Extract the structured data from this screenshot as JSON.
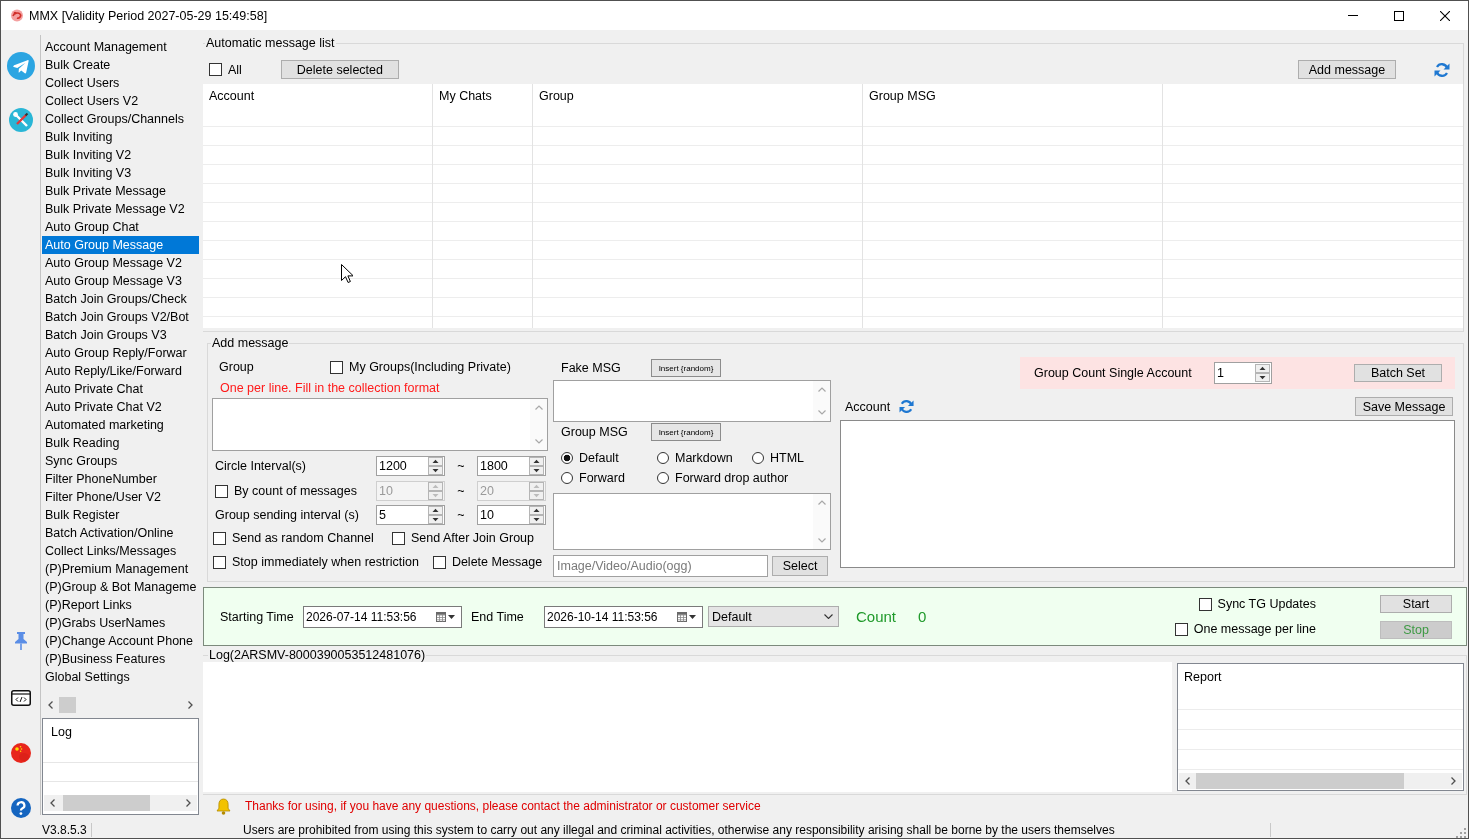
{
  "window": {
    "title": "MMX [Validity Period 2027-05-29 15:49:58]"
  },
  "sidebar": {
    "items": [
      {
        "label": "Account Management",
        "selected": false
      },
      {
        "label": "Bulk Create",
        "selected": false
      },
      {
        "label": "Collect Users",
        "selected": false
      },
      {
        "label": "Collect Users V2",
        "selected": false
      },
      {
        "label": "Collect Groups/Channels",
        "selected": false
      },
      {
        "label": "Bulk Inviting",
        "selected": false
      },
      {
        "label": "Bulk Inviting V2",
        "selected": false
      },
      {
        "label": "Bulk Inviting V3",
        "selected": false
      },
      {
        "label": "Bulk Private Message",
        "selected": false
      },
      {
        "label": "Bulk Private Message V2",
        "selected": false
      },
      {
        "label": "Auto Group Chat",
        "selected": false
      },
      {
        "label": "Auto Group Message",
        "selected": true
      },
      {
        "label": "Auto Group Message V2",
        "selected": false
      },
      {
        "label": "Auto Group Message V3",
        "selected": false
      },
      {
        "label": "Batch Join Groups/Check",
        "selected": false
      },
      {
        "label": "Batch Join Groups V2/Bot",
        "selected": false
      },
      {
        "label": "Batch Join Groups V3",
        "selected": false
      },
      {
        "label": "Auto Group Reply/Forwar",
        "selected": false
      },
      {
        "label": "Auto Reply/Like/Forward",
        "selected": false
      },
      {
        "label": "Auto Private Chat",
        "selected": false
      },
      {
        "label": "Auto Private Chat V2",
        "selected": false
      },
      {
        "label": "Automated marketing",
        "selected": false
      },
      {
        "label": "Bulk Reading",
        "selected": false
      },
      {
        "label": "Sync Groups",
        "selected": false
      },
      {
        "label": "Filter PhoneNumber",
        "selected": false
      },
      {
        "label": "Filter Phone/User V2",
        "selected": false
      },
      {
        "label": "Bulk Register",
        "selected": false
      },
      {
        "label": "Batch Activation/Online",
        "selected": false
      },
      {
        "label": "Collect Links/Messages",
        "selected": false
      },
      {
        "label": "(P)Premium Management",
        "selected": false
      },
      {
        "label": "(P)Group & Bot Manageme",
        "selected": false
      },
      {
        "label": "(P)Report Links",
        "selected": false
      },
      {
        "label": "(P)Grabs UserNames",
        "selected": false
      },
      {
        "label": "(P)Change Account Phone",
        "selected": false
      },
      {
        "label": "(P)Business Features",
        "selected": false
      },
      {
        "label": "Global Settings",
        "selected": false
      }
    ]
  },
  "sidebar_log": {
    "columns": [
      "Log"
    ]
  },
  "message_list": {
    "title": "Automatic message list",
    "select_all": {
      "label": "All",
      "checked": false
    },
    "delete_button": "Delete selected",
    "add_button": "Add message",
    "table": {
      "columns": [
        "Account",
        "My Chats",
        "Group",
        "Group MSG"
      ]
    }
  },
  "add_message": {
    "title": "Add message",
    "group_label": "Group",
    "my_groups": {
      "label": "My Groups(Including Private)",
      "checked": false
    },
    "hint": "One per line. Fill in the collection format",
    "intervals": [
      {
        "kind": "label",
        "label": "Circle Interval(s)",
        "from": "1200",
        "separator": "~",
        "to": "1800",
        "disabled": false
      },
      {
        "kind": "checkbox",
        "label": "By count of messages",
        "checked": false,
        "from": "10",
        "separator": "~",
        "to": "20",
        "disabled": true
      },
      {
        "kind": "label",
        "label": "Group sending interval (s)",
        "from": "5",
        "separator": "~",
        "to": "10",
        "disabled": false
      }
    ],
    "options": [
      {
        "label": "Send as random Channel",
        "checked": false
      },
      {
        "label": "Send After Join Group",
        "checked": false
      },
      {
        "label": "Stop immediately when restriction",
        "checked": false
      },
      {
        "label": "Delete Message",
        "checked": false
      }
    ],
    "fake_msg": {
      "label": "Fake MSG",
      "insert_button": "Insert {random}"
    },
    "group_msg": {
      "label": "Group MSG",
      "insert_button": "Insert {random}",
      "formats": [
        {
          "label": "Default",
          "selected": true
        },
        {
          "label": "Markdown",
          "selected": false
        },
        {
          "label": "HTML",
          "selected": false
        },
        {
          "label": "Forward",
          "selected": false
        },
        {
          "label": "Forward drop author",
          "selected": false
        }
      ]
    },
    "media": {
      "placeholder": "Image/Video/Audio(ogg)",
      "button": "Select"
    },
    "group_count": {
      "label": "Group Count Single Account",
      "value": "1",
      "button": "Batch Set"
    },
    "account": {
      "label": "Account",
      "button": "Save Message"
    }
  },
  "schedule": {
    "start_label": "Starting Time",
    "start_value": "2026-07-14 11:53:56",
    "end_label": "End Time",
    "end_value": "2026-10-14 11:53:56",
    "mode": "Default",
    "count_label": "Count",
    "count": "0",
    "options": [
      {
        "label": "Sync TG Updates",
        "checked": false
      },
      {
        "label": "One message per line",
        "checked": false
      }
    ],
    "buttons": [
      {
        "label": "Start",
        "disabled": false
      },
      {
        "label": "Stop",
        "disabled": true
      }
    ]
  },
  "log": {
    "title": "Log(2ARSMV-8000390053512481076)",
    "report_columns": [
      "Report"
    ]
  },
  "notice": "Thanks for using, if you have any questions, please contact the administrator or customer service",
  "status_bar": {
    "version": "V3.8.5.3",
    "message": "Users are prohibited from using this system to carry out any illegal and criminal activities, otherwise any responsibility arising shall be borne by the users themselves"
  }
}
